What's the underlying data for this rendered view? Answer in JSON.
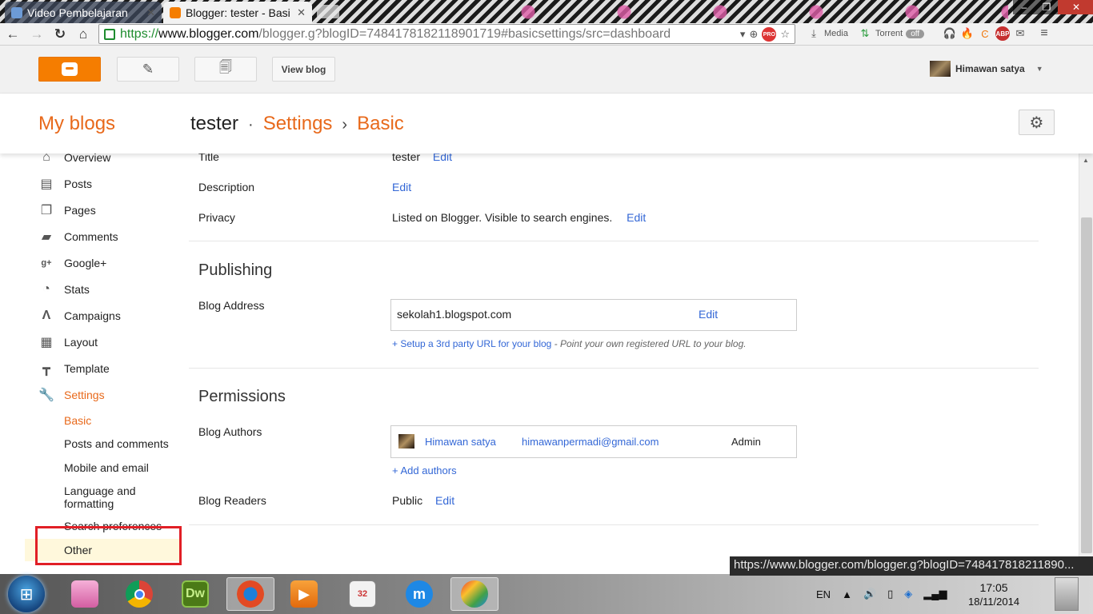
{
  "browser": {
    "tabs": [
      {
        "title": "Video Pembelajaran",
        "active": false
      },
      {
        "title": "Blogger: tester - Basi",
        "active": true
      }
    ],
    "url": {
      "scheme": "https://",
      "host": "www.blogger.com",
      "path": "/blogger.g?blogID=7484178182118901719#basicsettings/src=dashboard"
    },
    "extensions": {
      "media_label": "Media",
      "torrent_label": "Torrent",
      "torrent_state": "off",
      "adblock_label": "ABP"
    }
  },
  "header": {
    "view_blog_label": "View blog",
    "user_name": "Himawan satya"
  },
  "title_bar": {
    "my_blogs": "My blogs",
    "blog_name": "tester",
    "dot": "·",
    "settings": "Settings",
    "arrow": "›",
    "section": "Basic"
  },
  "sidebar": {
    "items": [
      {
        "label": "Overview",
        "icon": "home-icon"
      },
      {
        "label": "Posts",
        "icon": "posts-icon"
      },
      {
        "label": "Pages",
        "icon": "pages-icon"
      },
      {
        "label": "Comments",
        "icon": "comments-icon"
      },
      {
        "label": "Google+",
        "icon": "google-plus-icon"
      },
      {
        "label": "Stats",
        "icon": "stats-icon"
      },
      {
        "label": "Campaigns",
        "icon": "campaigns-icon"
      },
      {
        "label": "Layout",
        "icon": "layout-icon"
      },
      {
        "label": "Template",
        "icon": "template-icon"
      },
      {
        "label": "Settings",
        "icon": "wrench-icon"
      }
    ],
    "settings_sub": [
      "Basic",
      "Posts and comments",
      "Mobile and email",
      "Language and formatting",
      "Search preferences",
      "Other"
    ]
  },
  "basic": {
    "title_label": "Title",
    "title_value": "tester",
    "description_label": "Description",
    "privacy_label": "Privacy",
    "privacy_value": "Listed on Blogger. Visible to search engines.",
    "edit": "Edit"
  },
  "publishing": {
    "heading": "Publishing",
    "blog_address_label": "Blog Address",
    "blog_address_value": "sekolah1.blogspot.com",
    "setup_link": "+ Setup a 3rd party URL for your blog",
    "setup_hint": " - Point your own registered URL to your blog."
  },
  "permissions": {
    "heading": "Permissions",
    "blog_authors_label": "Blog Authors",
    "author_name": "Himawan satya",
    "author_email": "himawanpermadi@gmail.com",
    "author_role": "Admin",
    "add_authors": "+ Add authors",
    "blog_readers_label": "Blog Readers",
    "blog_readers_value": "Public"
  },
  "status_bar": {
    "url": "https://www.blogger.com/blogger.g?blogID=748417818211890..."
  },
  "taskbar": {
    "dw_label": "Dw",
    "language": "EN",
    "time": "17:05",
    "date": "18/11/2014"
  },
  "colors": {
    "blogger_orange": "#f57d00",
    "link_blue": "#3367d6",
    "highlight_red": "#e11f26"
  }
}
